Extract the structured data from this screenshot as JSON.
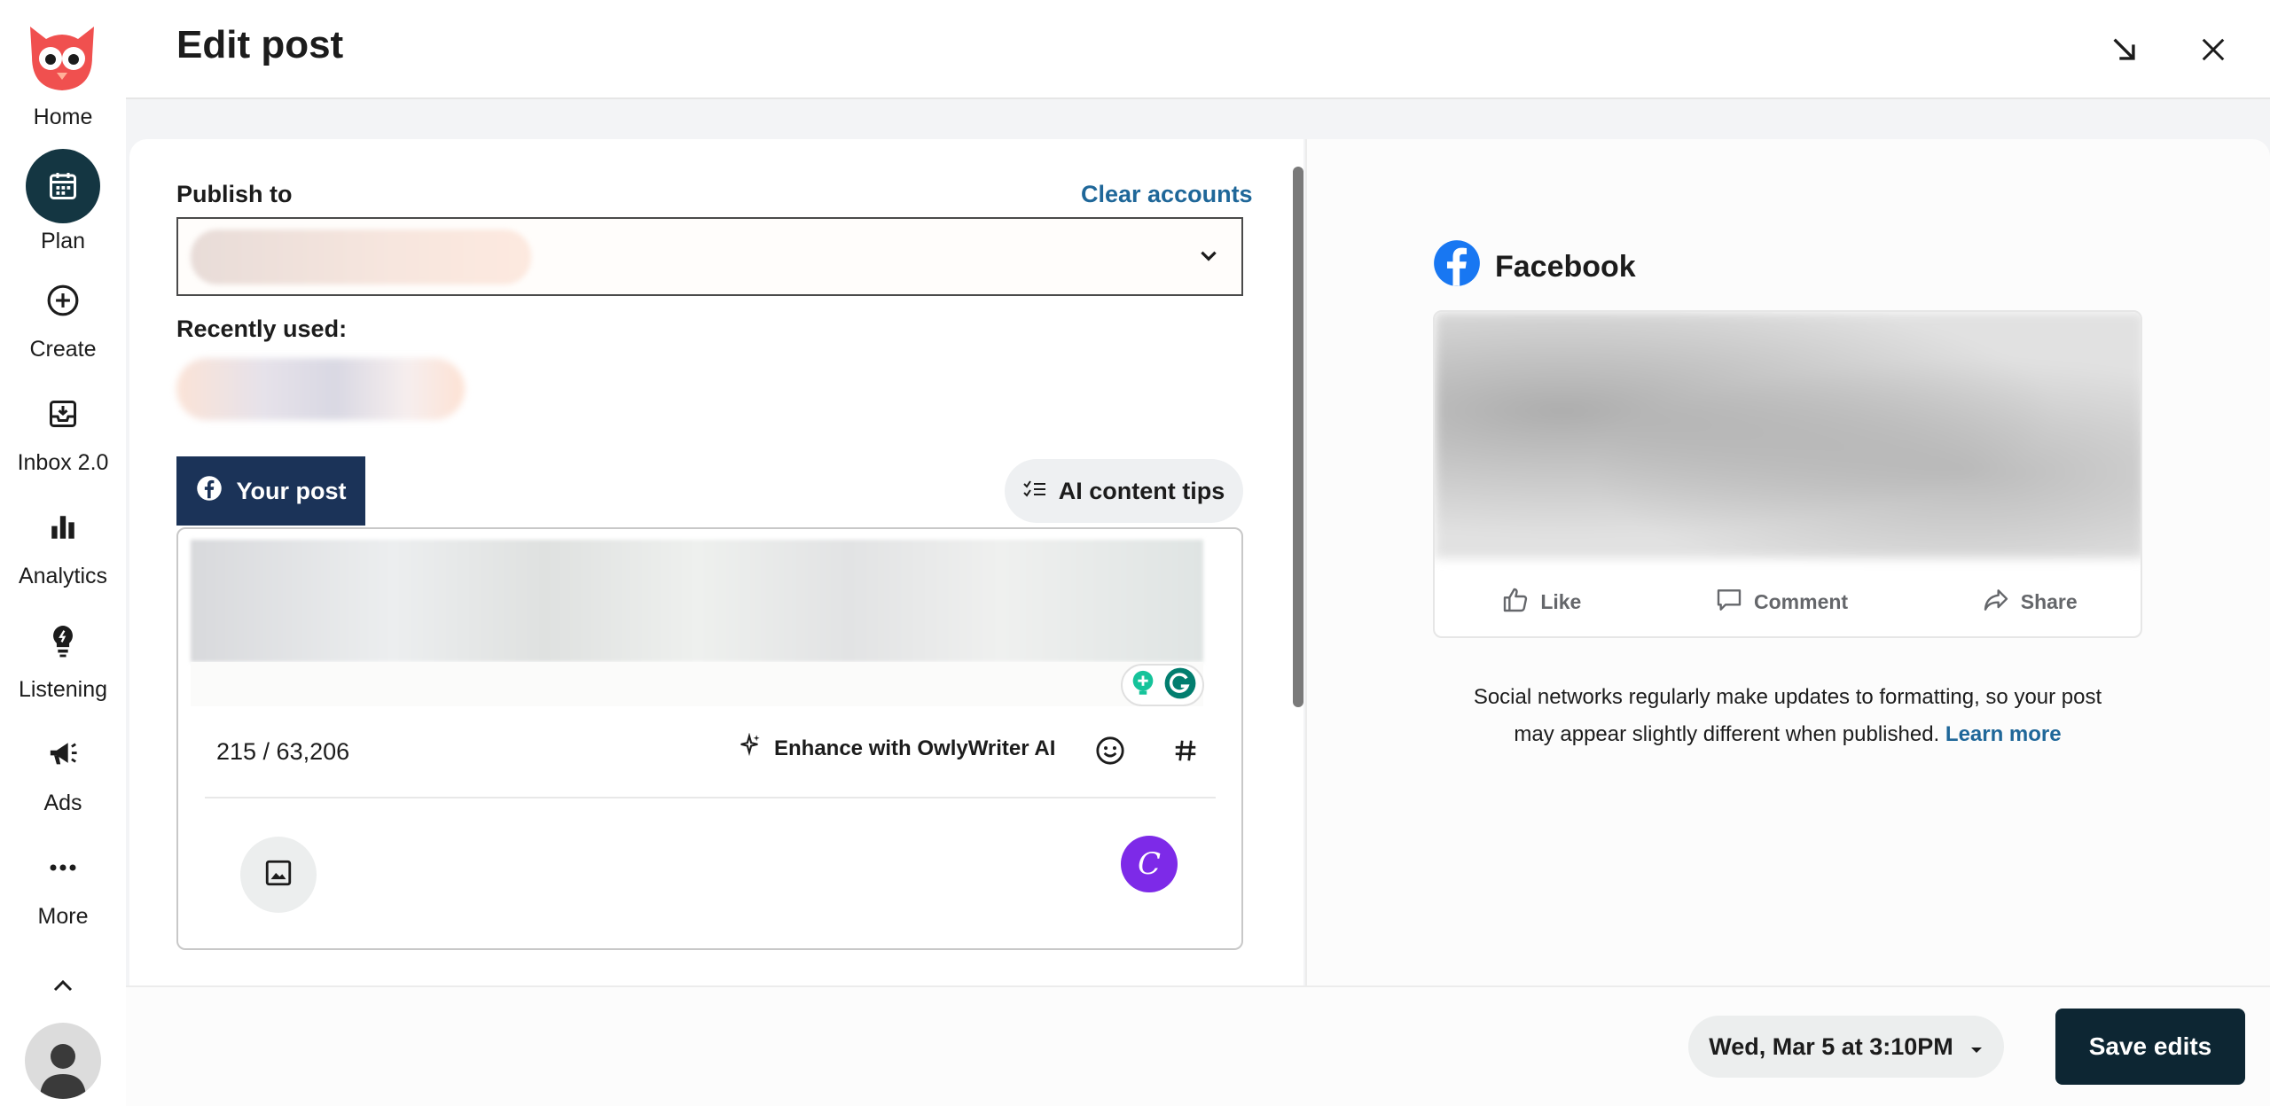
{
  "header": {
    "title": "Edit post"
  },
  "sidebar": {
    "items": [
      {
        "label": "Home",
        "icon": "owl-logo-icon"
      },
      {
        "label": "Plan",
        "icon": "calendar-icon",
        "active": true
      },
      {
        "label": "Create",
        "icon": "plus-circle-icon"
      },
      {
        "label": "Inbox 2.0",
        "icon": "inbox-icon"
      },
      {
        "label": "Analytics",
        "icon": "bar-chart-icon"
      },
      {
        "label": "Listening",
        "icon": "lightbulb-icon"
      },
      {
        "label": "Ads",
        "icon": "megaphone-icon"
      },
      {
        "label": "More",
        "icon": "more-dots-icon"
      }
    ]
  },
  "publish": {
    "label": "Publish to",
    "clear_label": "Clear accounts"
  },
  "recent": {
    "label": "Recently used:"
  },
  "tabs": {
    "your_post": "Your post",
    "ai_tips": "AI content tips"
  },
  "editor": {
    "counter": "215 / 63,206",
    "enhance_label": "Enhance with OwlyWriter AI",
    "canva_letter": "C"
  },
  "preview": {
    "network": "Facebook",
    "actions": [
      "Like",
      "Comment",
      "Share"
    ],
    "disclaimer": "Social networks regularly make updates to formatting, so your post may appear slightly different when published.",
    "learn_more": "Learn more"
  },
  "footer": {
    "date": "Wed, Mar 5 at 3:10PM",
    "save_label": "Save edits"
  },
  "colors": {
    "brand_navy": "#0d2633",
    "tab_navy": "#1b3358",
    "link_blue": "#1f6799",
    "facebook_blue": "#1877f2",
    "canva_purple": "#7d2ae8",
    "owl_red": "#f0504f"
  }
}
